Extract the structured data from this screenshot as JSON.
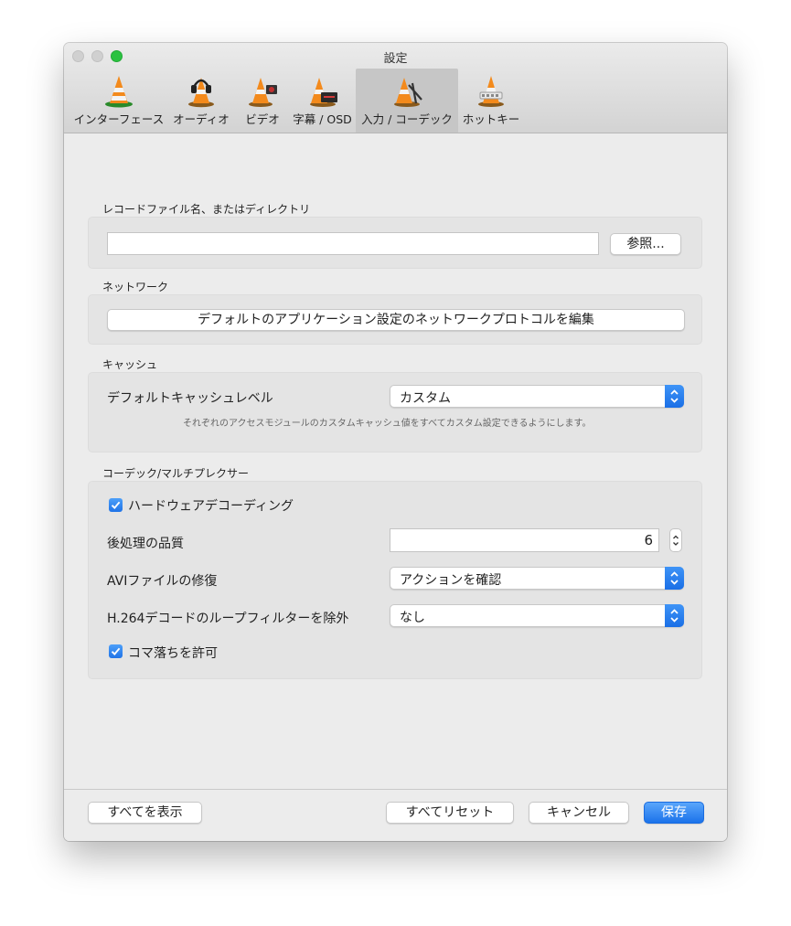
{
  "window": {
    "title": "設定"
  },
  "tabs": [
    {
      "label": "インターフェース",
      "icon": "interface-cone-icon",
      "active": false
    },
    {
      "label": "オーディオ",
      "icon": "headphones-cone-icon",
      "active": false
    },
    {
      "label": "ビデオ",
      "icon": "video-cone-icon",
      "active": false
    },
    {
      "label": "字幕 / OSD",
      "icon": "subtitles-cone-icon",
      "active": false
    },
    {
      "label": "入力 / コーデック",
      "icon": "input-codec-cone-icon",
      "active": true
    },
    {
      "label": "ホットキー",
      "icon": "hotkeys-cone-icon",
      "active": false
    }
  ],
  "record": {
    "section_label": "レコードファイル名、またはディレクトリ",
    "path_value": "",
    "browse_label": "参照..."
  },
  "network": {
    "section_label": "ネットワーク",
    "edit_button_label": "デフォルトのアプリケーション設定のネットワークプロトコルを編集"
  },
  "cache": {
    "section_label": "キャッシュ",
    "level_label": "デフォルトキャッシュレベル",
    "level_value": "カスタム",
    "hint": "それぞれのアクセスモジュールのカスタムキャッシュ値をすべてカスタム設定できるようにします。"
  },
  "codec": {
    "section_label": "コーデック/マルチプレクサー",
    "hw_decoding_label": "ハードウェアデコーディング",
    "hw_decoding_checked": true,
    "pp_quality_label": "後処理の品質",
    "pp_quality_value": "6",
    "avi_repair_label": "AVIファイルの修復",
    "avi_repair_value": "アクションを確認",
    "h264_loop_label": "H.264デコードのループフィルターを除外",
    "h264_loop_value": "なし",
    "frame_drop_label": "コマ落ちを許可",
    "frame_drop_checked": true
  },
  "footer": {
    "show_all_label": "すべてを表示",
    "reset_all_label": "すべてリセット",
    "cancel_label": "キャンセル",
    "save_label": "保存"
  },
  "colors": {
    "accent": "#1b72ea",
    "window_bg": "#ececec"
  }
}
